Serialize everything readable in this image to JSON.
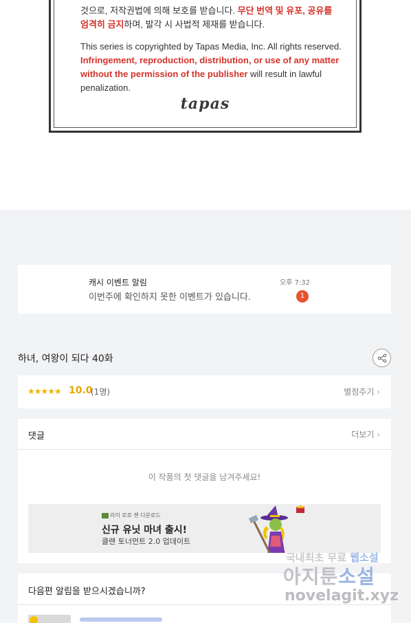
{
  "notice": {
    "ko_line1_a": "것으로, 저작권법에 의해 보호를 받습니다. ",
    "ko_line1_red": "무단 번역 및 유포, 공유를",
    "ko_line2_red": "엄격히 금지",
    "ko_line2_b": "하며, 발각 시 사법적 제재를 받습니다.",
    "en_a": "This series is copyrighted by Tapas Media, Inc. All rights reserved. ",
    "en_red": "Infringement, reproduction, distribution, or use of any matter without the permission of the publisher",
    "en_b": " will result in lawful penalization.",
    "logo": "tapas"
  },
  "notification": {
    "title": "캐시 이벤트 알림",
    "message": "이번주에 확인하지 못한 이벤트가 있습니다.",
    "time": "오후 7:32",
    "badge": "1"
  },
  "episode": {
    "title": "하녀, 여왕이 되다 40화"
  },
  "rating": {
    "stars": "★★★★★",
    "score": "10.0",
    "count": "(1명)",
    "rate_link": "별점주기"
  },
  "comments": {
    "title": "댓글",
    "more": "더보기",
    "empty": "이 작품의 첫 댓글을 남겨주세요!"
  },
  "ad": {
    "source": "라이 로로 랜 다운로드",
    "title": "신규 유닛 마녀 출시!",
    "subtitle": "클랜 토너먼트 2.0 업데이트"
  },
  "subscribe": {
    "title": "다음편 알림을 받으시겠습니까?"
  },
  "watermark": {
    "line1_a": "국내최초 무료 ",
    "line1_b": "웹소설",
    "line2_a": "아지툰",
    "line2_b": "소설",
    "line3": "novelagit.xyz"
  },
  "icons": {
    "share": "share-icon",
    "chevron": "chevron-right-icon"
  },
  "colors": {
    "accent_red": "#d4332a",
    "badge": "#e8532f",
    "star": "#f0b400"
  }
}
